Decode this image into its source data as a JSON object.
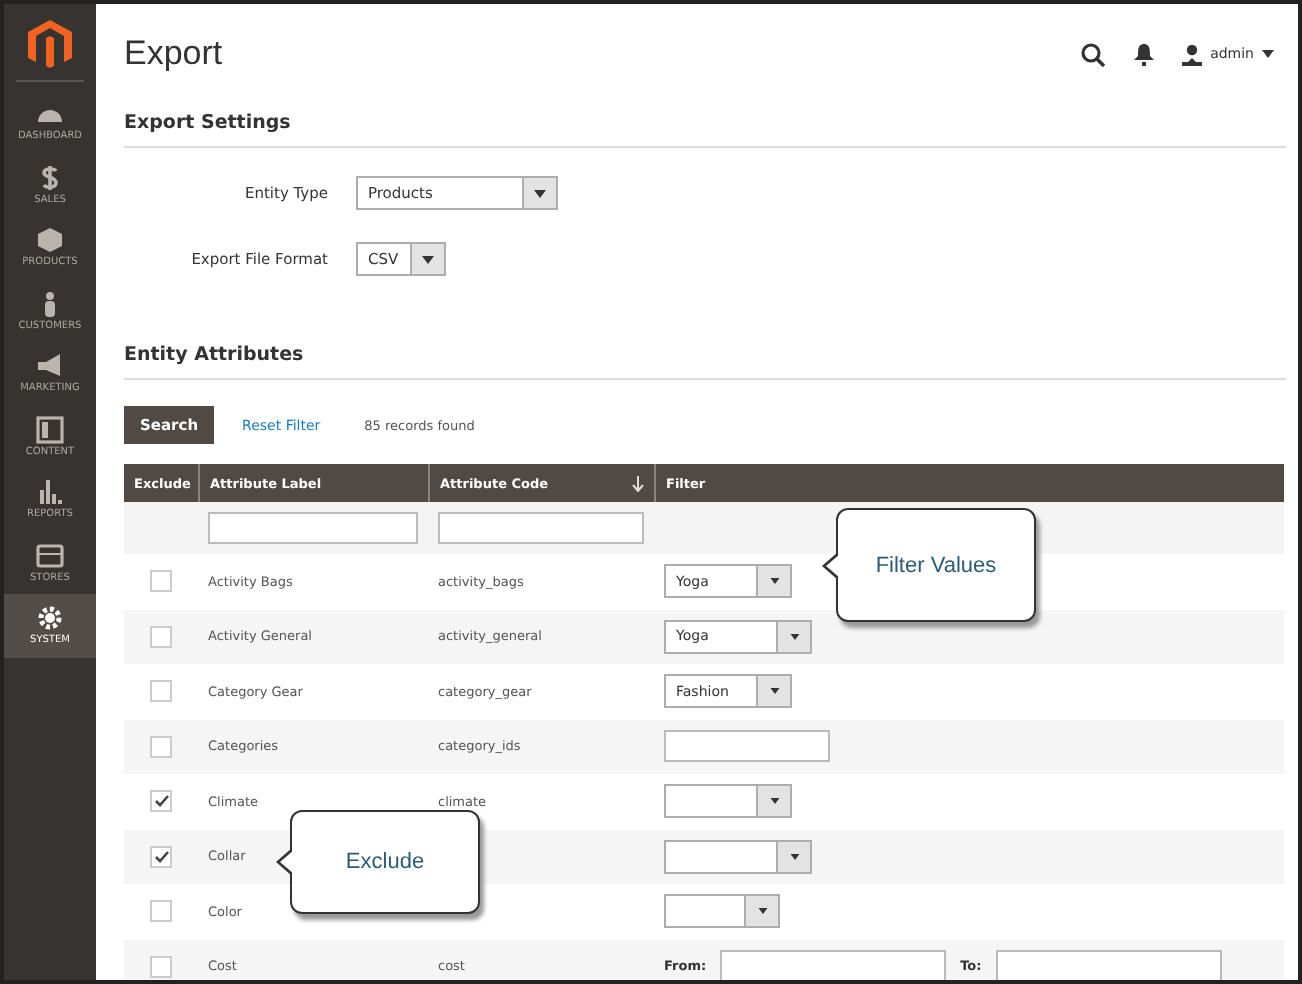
{
  "sidebar": {
    "items": [
      {
        "label": "DASHBOARD",
        "selected": false
      },
      {
        "label": "SALES",
        "selected": false
      },
      {
        "label": "PRODUCTS",
        "selected": false
      },
      {
        "label": "CUSTOMERS",
        "selected": false
      },
      {
        "label": "MARKETING",
        "selected": false
      },
      {
        "label": "CONTENT",
        "selected": false
      },
      {
        "label": "REPORTS",
        "selected": false
      },
      {
        "label": "STORES",
        "selected": false
      },
      {
        "label": "SYSTEM",
        "selected": true
      }
    ]
  },
  "page_title": "Export",
  "user": "admin",
  "export_settings": {
    "title": "Export Settings",
    "fields": [
      {
        "label": "Entity Type",
        "value": "Products"
      },
      {
        "label": "Export File Format",
        "value": "CSV"
      }
    ]
  },
  "entity_attributes": {
    "title": "Entity Attributes",
    "search_button": "Search",
    "reset_link": "Reset Filter",
    "records": "85 records found",
    "columns": [
      "Exclude",
      "Attribute Label",
      "Attribute Code",
      "Filter"
    ],
    "rows": [
      {
        "checked": false,
        "label": "Activity Bags",
        "code": "activity_bags",
        "filter": {
          "kind": "select",
          "value": "Yoga"
        }
      },
      {
        "checked": false,
        "label": "Activity General",
        "code": "activity_general",
        "filter": {
          "kind": "select",
          "value": "Yoga"
        }
      },
      {
        "checked": false,
        "label": "Category Gear",
        "code": "category_gear",
        "filter": {
          "kind": "select",
          "value": "Fashion"
        }
      },
      {
        "checked": false,
        "label": "Categories",
        "code": "category_ids",
        "filter": {
          "kind": "text"
        }
      },
      {
        "checked": true,
        "label": "Climate",
        "code": "climate",
        "filter": {
          "kind": "select"
        }
      },
      {
        "checked": true,
        "label": "Collar",
        "filter": {
          "kind": "select"
        }
      },
      {
        "checked": false,
        "label": "Color",
        "filter": {
          "kind": "select"
        }
      },
      {
        "checked": false,
        "label": "Cost",
        "code": "cost",
        "filter": {
          "kind": "range",
          "from": "From:",
          "to": "To:"
        }
      }
    ]
  },
  "callouts": [
    {
      "text": "Filter Values"
    },
    {
      "text": "Exclude"
    }
  ]
}
